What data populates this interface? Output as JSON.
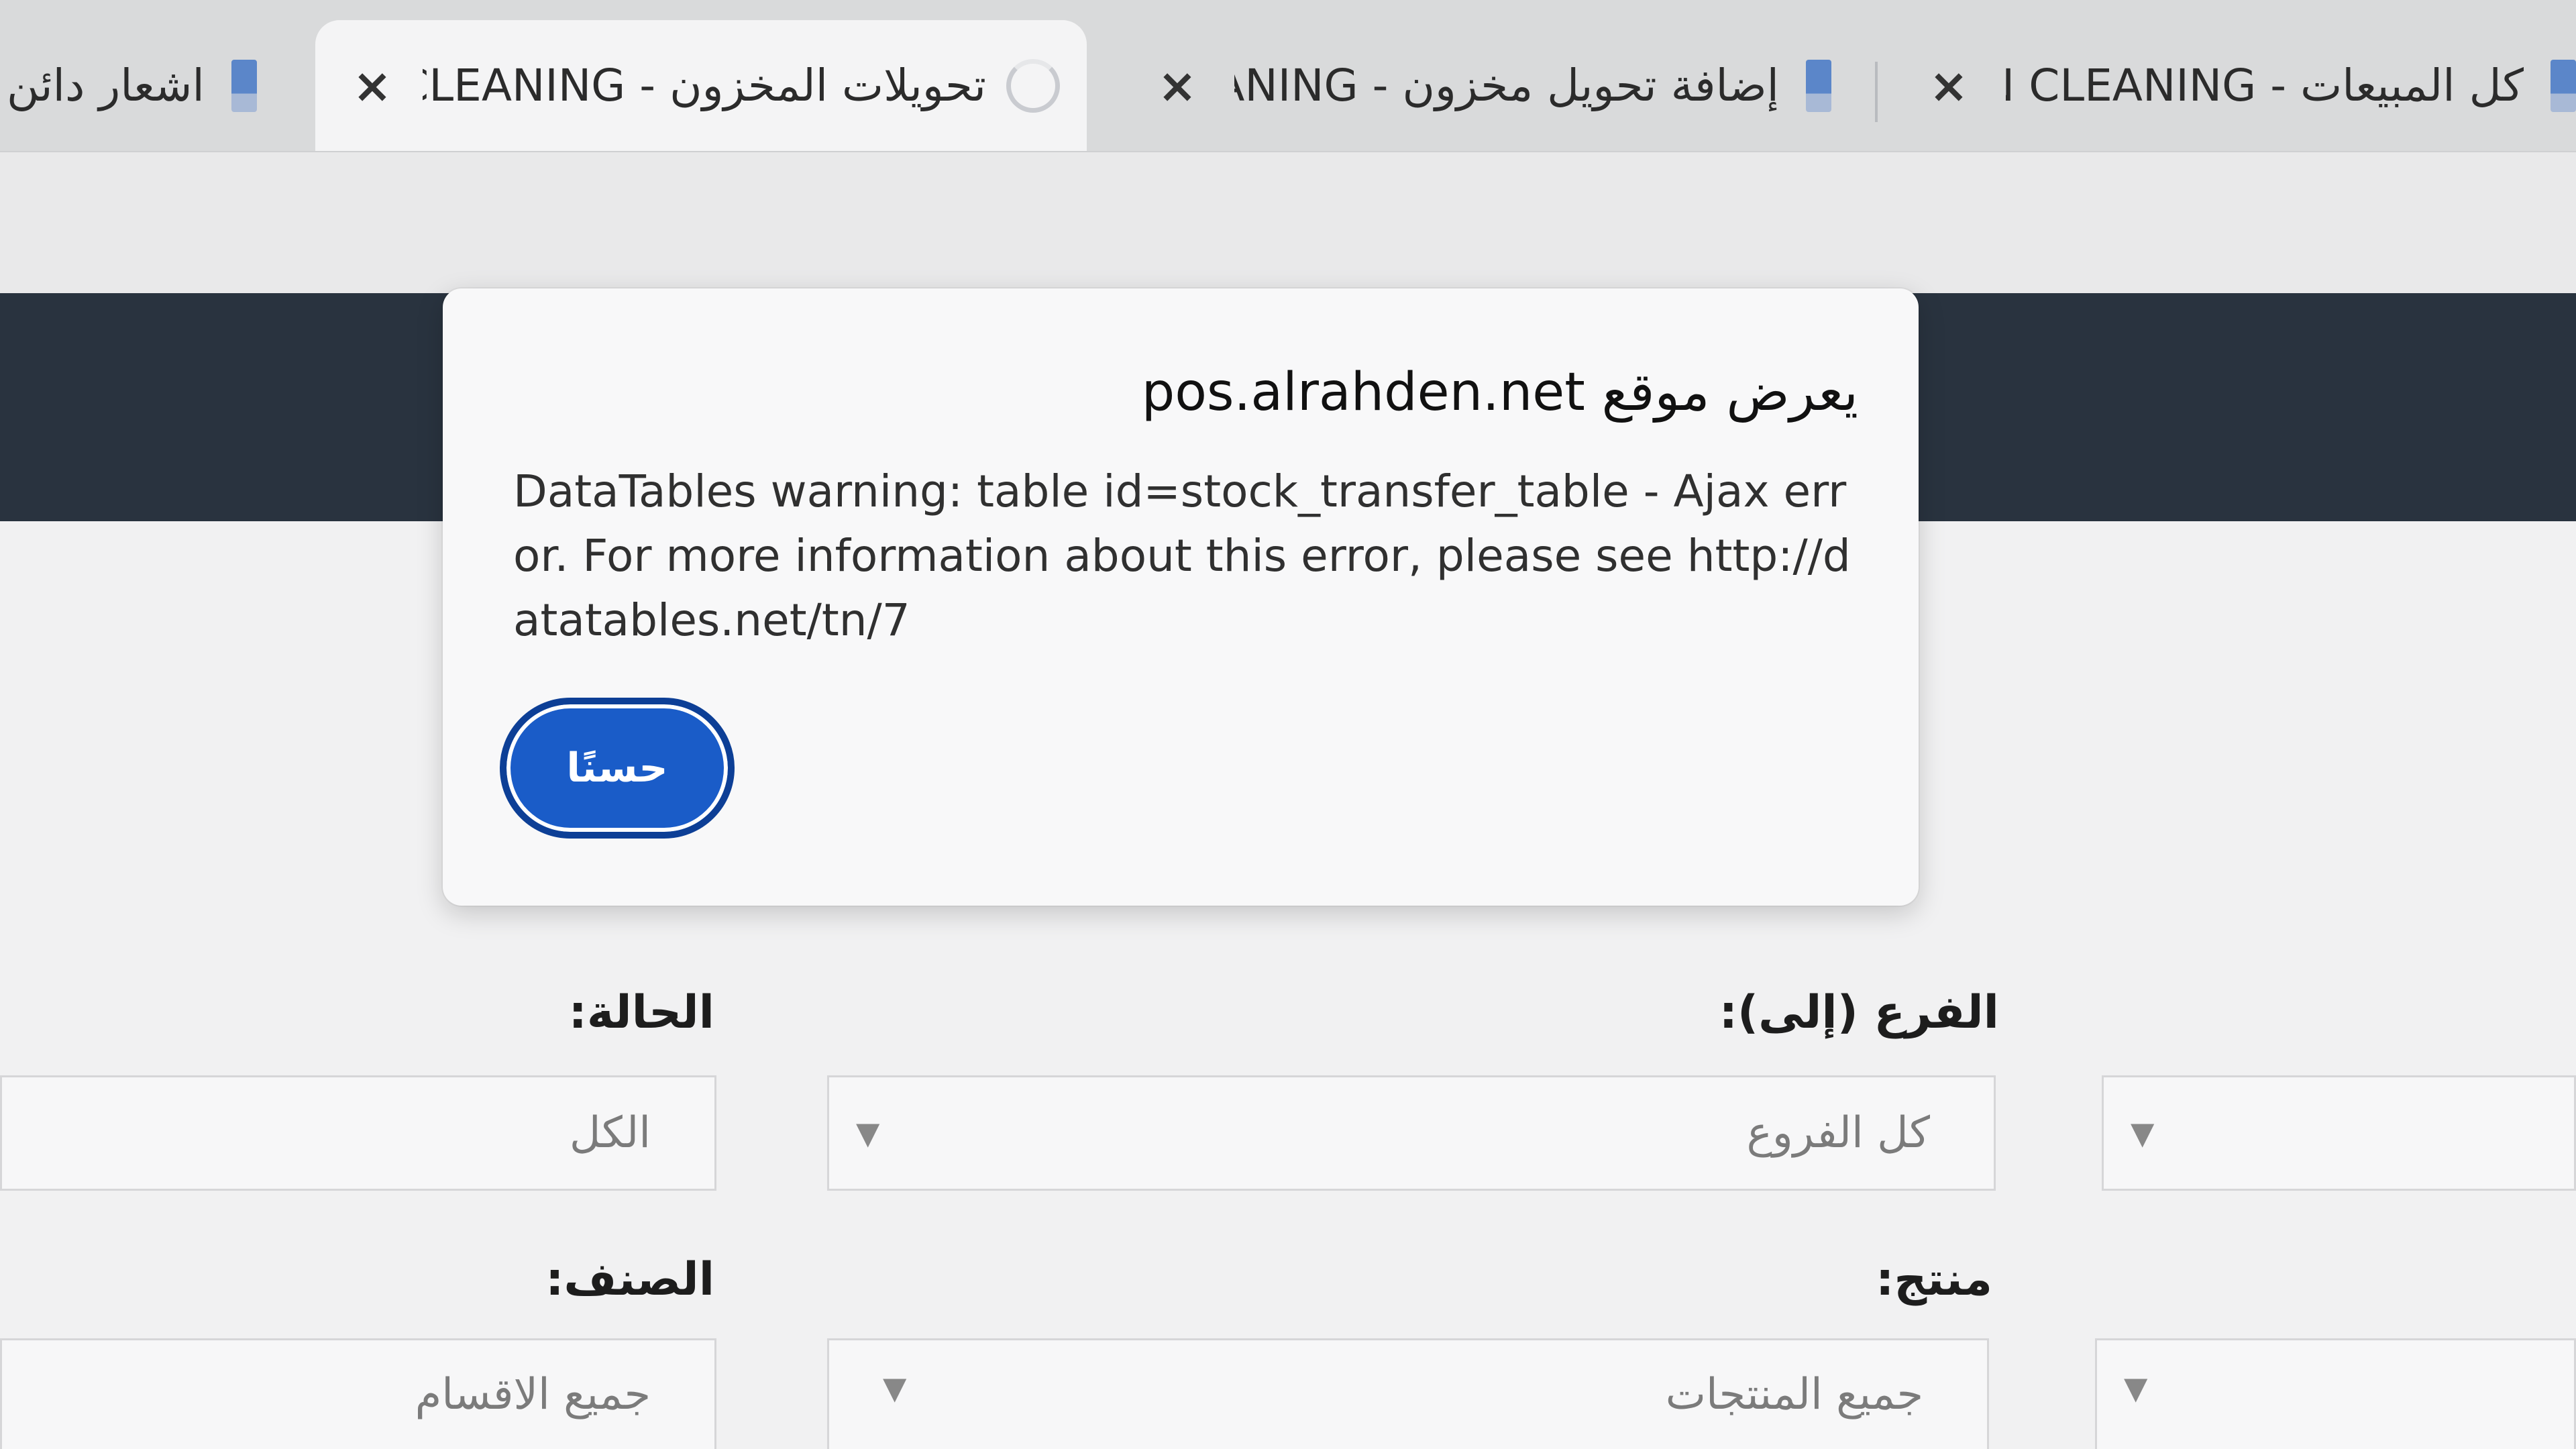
{
  "tabs": [
    {
      "title": "اشعار دائن",
      "close": "",
      "favicon": "page-icon",
      "active": false
    },
    {
      "title": "تحويلات المخزون - N CLEANING",
      "close": "×",
      "favicon": "loading-spinner-icon",
      "active": true
    },
    {
      "title": "إضافة تحويل مخزون - CLEANING",
      "close": "×",
      "favicon": "page-icon",
      "active": false
    },
    {
      "title": "كل المبيعات - HDEN CLEANING",
      "close": "×",
      "favicon": "page-icon",
      "active": false
    }
  ],
  "dialog": {
    "title": "يعرض موقع pos.alrahden.net",
    "message": "DataTables warning: table id=stock_transfer_table - Ajax error. For more information about this error, please see http://datatables.net/tn/7",
    "ok_label": "حسنًا"
  },
  "filters": {
    "status_label": "الحالة:",
    "status_value": "الكل",
    "branch_to_label": "الفرع (إلى):",
    "branch_to_value": "كل الفروع",
    "category_label": "الصنف:",
    "category_value": "جميع الاقسام",
    "product_label": "منتج:",
    "product_value": "جميع المنتجات",
    "caret": "▼"
  },
  "colors": {
    "header_band": "#29333f",
    "ok_button": "#1a5cc8",
    "tabstrip": "#d9dadb"
  }
}
